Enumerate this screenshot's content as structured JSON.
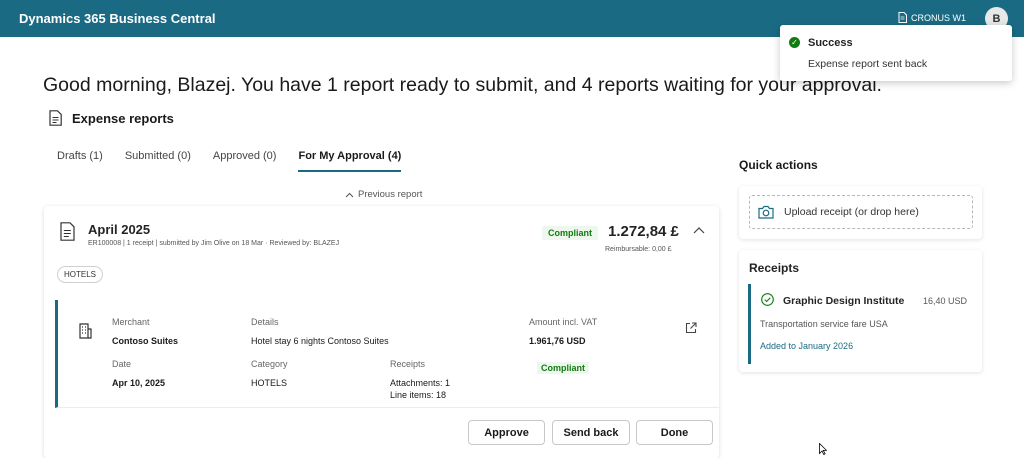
{
  "app": {
    "title": "Dynamics 365 Business Central",
    "company": "CRONUS W1",
    "user_initial": "B",
    "brand_color": "#1b6a84"
  },
  "toast": {
    "title": "Success",
    "message": "Expense report sent back"
  },
  "greeting": "Good morning, Blazej. You have 1 report ready to submit, and 4 reports waiting for your approval.",
  "section": {
    "title": "Expense reports"
  },
  "tabs": [
    {
      "label": "Drafts (1)"
    },
    {
      "label": "Submitted (0)"
    },
    {
      "label": "Approved (0)"
    },
    {
      "label": "For My Approval (4)",
      "active": true
    }
  ],
  "previous_report": "Previous report",
  "report": {
    "title": "April 2025",
    "subtitle": "ER100008 | 1 receipt | submitted by Jim Olive on 18 Mar · Reviewed by: BLAZEJ",
    "status": "Compliant",
    "amount": "1.272,84 £",
    "reimbursable": "Reimbursable: 0,00 £",
    "tag": "HOTELS",
    "line": {
      "merchant_label": "Merchant",
      "merchant": "Contoso Suites",
      "details_label": "Details",
      "details": "Hotel stay 6 nights Contoso Suites",
      "amount_label": "Amount incl. VAT",
      "amount": "1.961,76 USD",
      "date_label": "Date",
      "date": "Apr 10, 2025",
      "category_label": "Category",
      "category": "HOTELS",
      "receipts_label": "Receipts",
      "attachments": "Attachments: 1",
      "line_items": "Line items: 18",
      "status": "Compliant"
    },
    "buttons": {
      "approve": "Approve",
      "send_back": "Send back",
      "done": "Done"
    }
  },
  "quick_actions": {
    "title": "Quick actions",
    "upload": "Upload receipt (or drop here)"
  },
  "receipts": {
    "title": "Receipts",
    "items": [
      {
        "name": "Graphic Design Institute",
        "amount": "16,40 USD",
        "description": "Transportation service fare USA",
        "link": "Added to January 2026"
      }
    ]
  }
}
